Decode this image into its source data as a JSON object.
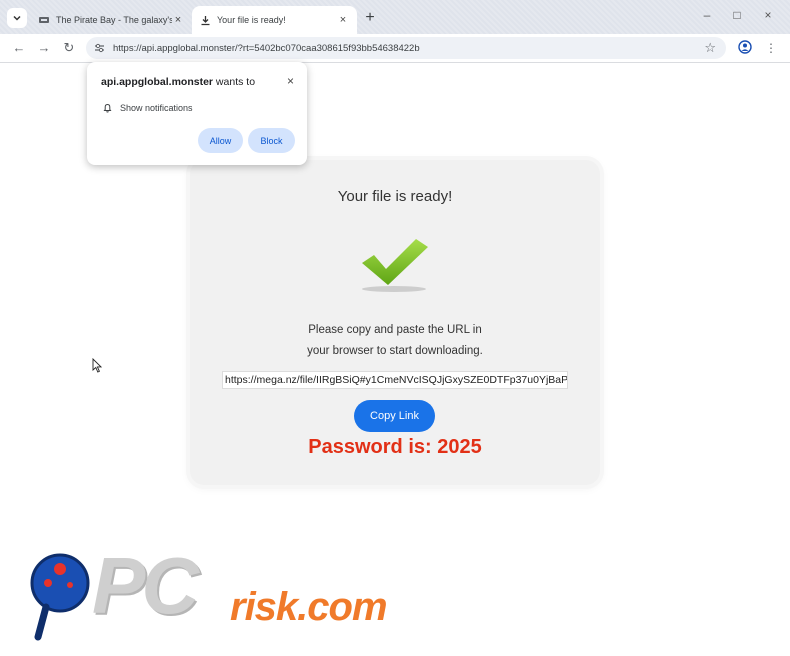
{
  "browser": {
    "tabs": [
      {
        "title": "The Pirate Bay - The galaxy's m",
        "active": false
      },
      {
        "title": "Your file is ready!",
        "active": true
      }
    ],
    "new_tab_symbol": "+",
    "address_url": "https://api.appglobal.monster/?rt=5402bc070caa308615f93bb54638422b"
  },
  "notification_popup": {
    "site": "api.appglobal.monster",
    "suffix": " wants to",
    "permission": "Show notifications",
    "allow_label": "Allow",
    "block_label": "Block",
    "close_symbol": "×"
  },
  "page": {
    "title": "Your file is ready!",
    "instruction_line1": "Please copy and paste the URL in",
    "instruction_line2": "your browser to start downloading.",
    "download_url": "https://mega.nz/file/IIRgBSiQ#y1CmeNVcISQJjGxySZE0DTFp37u0YjBaP",
    "copy_button_label": "Copy Link",
    "password_text": "Password is: 2025"
  },
  "watermark": {
    "brand_pc": "PC",
    "brand_rest": "risk.com"
  },
  "colors": {
    "accent_blue": "#1a73e8",
    "password_red": "#e23016",
    "check_green": "#7cc21f",
    "watermark_orange": "#f07a2a"
  }
}
